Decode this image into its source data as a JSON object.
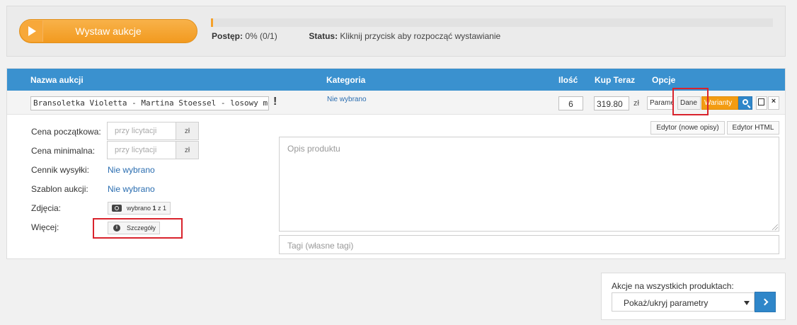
{
  "top": {
    "start_label": "Wystaw aukcje",
    "progress_label": "Postęp:",
    "progress_value": "0% (0/1)",
    "progress_fraction": 0,
    "status_label": "Status:",
    "status_value": "Kliknij przycisk aby rozpocząć wystawianie"
  },
  "table": {
    "headers": {
      "name": "Nazwa aukcji",
      "category": "Kategoria",
      "qty": "Ilość",
      "buy_now": "Kup Teraz",
      "options": "Opcje"
    },
    "row": {
      "name": "Bransoletka Violetta - Martina Stoessel - losowy model",
      "warning": "!",
      "category": "Nie wybrano",
      "qty": "6",
      "price": "319.80",
      "currency": "zł",
      "btn_param": "Parametry",
      "btn_dane": "Dane",
      "btn_warianty": "Warianty",
      "btn_close": "×"
    }
  },
  "form": {
    "start_price_label": "Cena początkowa:",
    "min_price_label": "Cena minimalna:",
    "price_placeholder": "przy licytacji",
    "currency": "zł",
    "shipping_label": "Cennik wysyłki:",
    "shipping_value": "Nie wybrano",
    "template_label": "Szablon aukcji:",
    "template_value": "Nie wybrano",
    "photos_label": "Zdjęcia:",
    "photos_btn_pre": "wybrano ",
    "photos_btn_count": "1",
    "photos_btn_post": " z 1",
    "more_label": "Więcej:",
    "details_btn": "Szczegóły",
    "info_glyph": "i",
    "editor_new": "Edytor (nowe opisy)",
    "editor_html": "Edytor HTML",
    "desc_placeholder": "Opis produktu",
    "tags_placeholder": "Tagi (własne tagi)"
  },
  "bottom": {
    "label": "Akcje na wszystkich produktach:",
    "selected": "Pokaż/ukryj parametry"
  },
  "colors": {
    "accent_orange": "#f39c12",
    "header_blue": "#3a91cf",
    "link_blue": "#2a6db0",
    "highlight_red": "#d9232d"
  },
  "icons": [
    "play-icon",
    "warning-icon",
    "search-icon",
    "copy-icon",
    "close-icon",
    "camera-icon",
    "info-icon",
    "chevron-down-icon",
    "chevron-right-icon"
  ]
}
